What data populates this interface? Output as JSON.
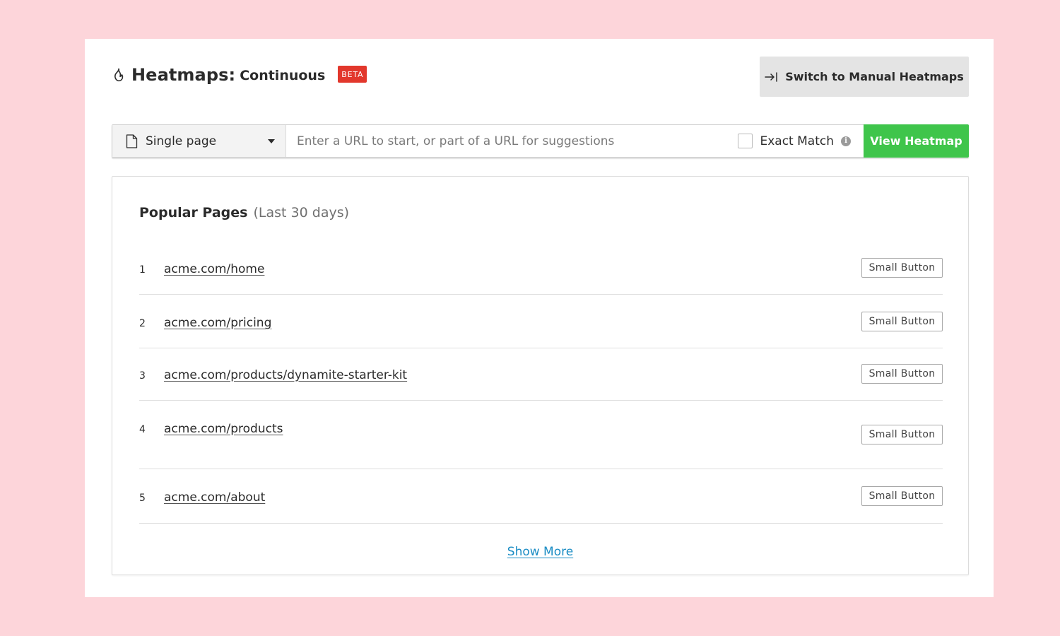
{
  "header": {
    "title_main": "Heatmaps:",
    "title_sub": "Continuous",
    "badge": "BETA",
    "switch_button_label": "Switch to Manual Heatmaps"
  },
  "search": {
    "scope_selected": "Single page",
    "url_placeholder": "Enter a URL to start, or part of a URL for suggestions",
    "url_value": "",
    "exact_match_label": "Exact Match",
    "exact_match_checked": false,
    "info_glyph": "i",
    "view_button_label": "View Heatmap"
  },
  "popular": {
    "title": "Popular Pages",
    "subtitle": "(Last 30 days)",
    "rows": [
      {
        "num": "1",
        "url": "acme.com/home",
        "button": "Small Button"
      },
      {
        "num": "2",
        "url": "acme.com/pricing",
        "button": "Small Button"
      },
      {
        "num": "3",
        "url": "acme.com/products/dynamite-starter-kit",
        "button": "Small Button"
      },
      {
        "num": "4",
        "url": "acme.com/products",
        "button": "Small Button"
      },
      {
        "num": "5",
        "url": "acme.com/about",
        "button": "Small Button"
      }
    ],
    "show_more": "Show More"
  },
  "colors": {
    "background": "#fdd5da",
    "beta_badge": "#e2372c",
    "primary_green": "#3fc54b",
    "link_blue": "#1a8cc4"
  },
  "icons": {
    "title_icon": "flame-icon",
    "switch_icon": "arrow-to-line-icon",
    "scope_icon": "page-icon",
    "caret_icon": "chevron-down-icon",
    "info_icon": "info-icon"
  }
}
